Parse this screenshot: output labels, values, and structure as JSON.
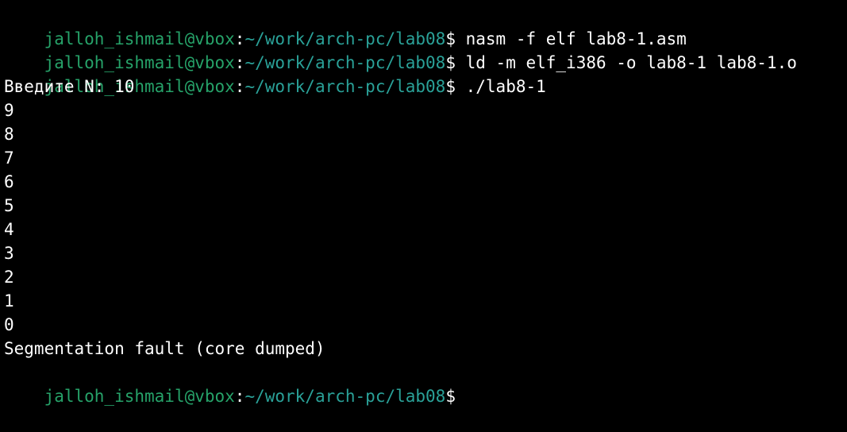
{
  "terminal": {
    "colors": {
      "background": "#000000",
      "foreground": "#ffffff",
      "user_host": "#26a269",
      "path": "#2aa198"
    },
    "prompt": {
      "user_host": "jalloh_ishmail@vbox",
      "separator": ":",
      "path": "~/work/arch-pc/lab08",
      "symbol": "$"
    },
    "commands": [
      " nasm -f elf lab8-1.asm",
      " ld -m elf_i386 -o lab8-1 lab8-1.o",
      " ./lab8-1"
    ],
    "output": [
      "Введите N: 10",
      "9",
      "8",
      "7",
      "6",
      "5",
      "4",
      "3",
      "2",
      "1",
      "0",
      "Segmentation fault (core dumped)"
    ]
  }
}
